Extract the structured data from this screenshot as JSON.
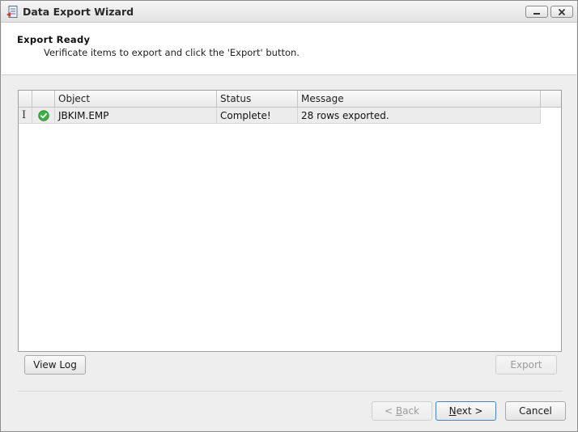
{
  "window": {
    "title": "Data Export Wizard",
    "icon": "db-export-icon",
    "controls": [
      "minimize-icon",
      "close-icon"
    ]
  },
  "header": {
    "title": "Export Ready",
    "description": "Verificate items to export and click the 'Export' button."
  },
  "grid": {
    "columns": [
      "",
      "",
      "Object",
      "Status",
      "Message",
      ""
    ],
    "rows": [
      {
        "cursor": "I",
        "status_icon": "check-circle-icon",
        "object": "JBKIM.EMP",
        "status": "Complete!",
        "message": "28 rows exported."
      }
    ]
  },
  "buttons": {
    "view_log": "View Log",
    "export": "Export",
    "back_prefix": "< ",
    "back_accel": "B",
    "back_rest": "ack",
    "next_accel": "N",
    "next_rest": "ext >",
    "cancel": "Cancel"
  },
  "colors": {
    "status_ok": "#3cb043",
    "primary_border": "#4d7fc4"
  }
}
